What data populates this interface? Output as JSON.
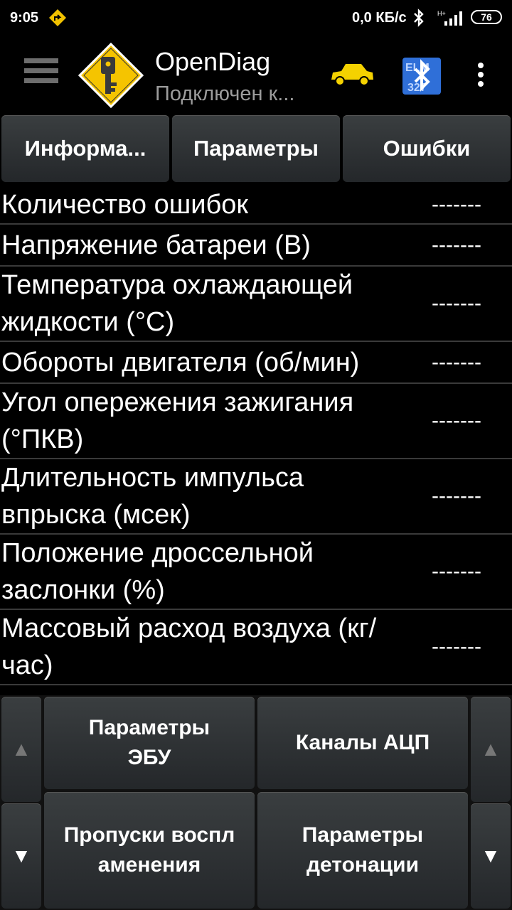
{
  "status_bar": {
    "time": "9:05",
    "net_speed": "0,0 КБ/с",
    "battery": "76"
  },
  "header": {
    "title": "OpenDiag",
    "subtitle": "Подключен к...",
    "icons": [
      "menu-icon",
      "app-logo-icon",
      "car-icon",
      "bluetooth-elm-icon",
      "overflow-menu-icon"
    ]
  },
  "tabs": [
    {
      "label": "Информа..."
    },
    {
      "label": "Параметры"
    },
    {
      "label": "Ошибки"
    }
  ],
  "params": [
    {
      "label": "Количество ошибок",
      "value": "-------"
    },
    {
      "label": "Напряжение батареи (В)",
      "value": "-------"
    },
    {
      "label": "Температура охлаждающей жидкости (°C)",
      "value": "-------"
    },
    {
      "label": "Обороты двигателя (об/мин)",
      "value": "-------"
    },
    {
      "label": "Угол опережения зажигания (°ПКВ)",
      "value": "-------"
    },
    {
      "label": "Длительность импульса впрыска (мсек)",
      "value": "-------"
    },
    {
      "label": "Положение дроссельной заслонки (%)",
      "value": "-------"
    },
    {
      "label": "Массовый расход воздуха (кг/час)",
      "value": "-------"
    }
  ],
  "bottom_buttons": [
    {
      "label": "Параметры ЭБУ"
    },
    {
      "label": "Каналы АЦП"
    },
    {
      "label": "Пропуски воспламенения"
    },
    {
      "label": "Параметры детонации"
    }
  ],
  "arrows": {
    "up": "▲",
    "down": "▼"
  }
}
